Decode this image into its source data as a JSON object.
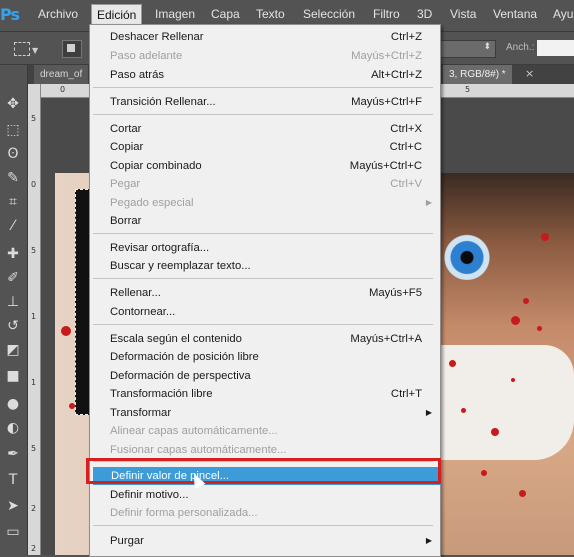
{
  "app": {
    "logo": "Ps"
  },
  "menubar": {
    "items": [
      "Archivo",
      "Edición",
      "Imagen",
      "Capa",
      "Texto",
      "Selección",
      "Filtro",
      "3D",
      "Vista",
      "Ventana",
      "Ayu"
    ]
  },
  "options_bar": {
    "anchor_label": "Anch.:"
  },
  "doc_tabs": {
    "tab1": "dream_of",
    "tab2": "3, RGB/8#) *"
  },
  "rulers": {
    "top": [
      "0",
      "5"
    ],
    "left": [
      "5",
      "0",
      "5",
      "1",
      "1",
      "5",
      "2",
      "2"
    ]
  },
  "edit_menu": {
    "items": [
      {
        "label": "Deshacer Rellenar",
        "shortcut": "Ctrl+Z",
        "enabled": true
      },
      {
        "label": "Paso adelante",
        "shortcut": "Mayús+Ctrl+Z",
        "enabled": false
      },
      {
        "label": "Paso atrás",
        "shortcut": "Alt+Ctrl+Z",
        "enabled": true
      },
      {
        "label": "Transición Rellenar...",
        "shortcut": "Mayús+Ctrl+F",
        "enabled": true
      },
      {
        "label": "Cortar",
        "shortcut": "Ctrl+X",
        "enabled": true
      },
      {
        "label": "Copiar",
        "shortcut": "Ctrl+C",
        "enabled": true
      },
      {
        "label": "Copiar combinado",
        "shortcut": "Mayús+Ctrl+C",
        "enabled": true
      },
      {
        "label": "Pegar",
        "shortcut": "Ctrl+V",
        "enabled": false
      },
      {
        "label": "Pegado especial",
        "shortcut": "",
        "enabled": false
      },
      {
        "label": "Borrar",
        "shortcut": "",
        "enabled": true
      },
      {
        "label": "Revisar ortografía...",
        "shortcut": "",
        "enabled": true
      },
      {
        "label": "Buscar y reemplazar texto...",
        "shortcut": "",
        "enabled": true
      },
      {
        "label": "Rellenar...",
        "shortcut": "Mayús+F5",
        "enabled": true
      },
      {
        "label": "Contornear...",
        "shortcut": "",
        "enabled": true
      },
      {
        "label": "Escala según el contenido",
        "shortcut": "Mayús+Ctrl+A",
        "enabled": true
      },
      {
        "label": "Deformación de posición libre",
        "shortcut": "",
        "enabled": true
      },
      {
        "label": "Deformación de perspectiva",
        "shortcut": "",
        "enabled": true
      },
      {
        "label": "Transformación libre",
        "shortcut": "Ctrl+T",
        "enabled": true
      },
      {
        "label": "Transformar",
        "shortcut": "",
        "enabled": true
      },
      {
        "label": "Alinear capas automáticamente...",
        "shortcut": "",
        "enabled": false
      },
      {
        "label": "Fusionar capas automáticamente...",
        "shortcut": "",
        "enabled": false
      },
      {
        "label": "Definir valor de pincel...",
        "shortcut": "",
        "enabled": true,
        "highlighted": true
      },
      {
        "label": "Definir motivo...",
        "shortcut": "",
        "enabled": true
      },
      {
        "label": "Definir forma personalizada...",
        "shortcut": "",
        "enabled": false
      },
      {
        "label": "Purgar",
        "shortcut": "",
        "enabled": true
      }
    ]
  },
  "colors": {
    "highlight": "#3d9bd8",
    "annotation_box": "#d42020"
  }
}
